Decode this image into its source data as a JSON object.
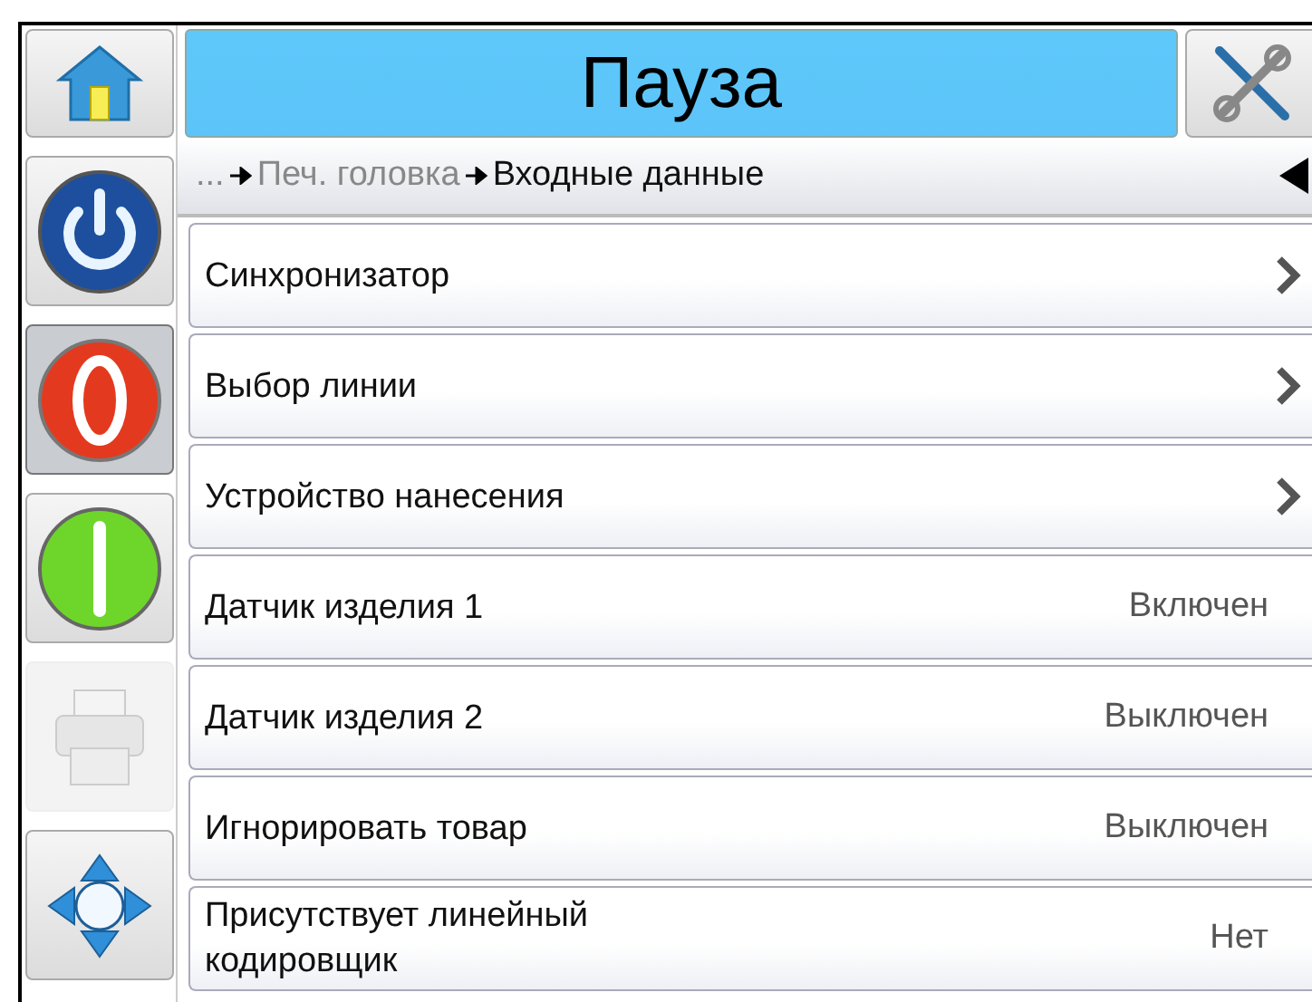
{
  "header": {
    "title": "Пауза"
  },
  "sidebar": [
    {
      "kind": "home",
      "selected": false,
      "disabled": false
    },
    {
      "kind": "power",
      "selected": false,
      "disabled": false
    },
    {
      "kind": "stop",
      "selected": true,
      "disabled": false
    },
    {
      "kind": "start",
      "selected": false,
      "disabled": false
    },
    {
      "kind": "printer",
      "selected": false,
      "disabled": true
    },
    {
      "kind": "navigate",
      "selected": false,
      "disabled": false
    }
  ],
  "breadcrumb": [
    {
      "label": "...",
      "current": false
    },
    {
      "label": "Печ. головка",
      "current": false
    },
    {
      "label": "Входные данные",
      "current": true
    }
  ],
  "rows": [
    {
      "kind": "nav",
      "label": "Синхронизатор"
    },
    {
      "kind": "nav",
      "label": "Выбор линии"
    },
    {
      "kind": "nav",
      "label": "Устройство нанесения"
    },
    {
      "kind": "value",
      "label": "Датчик изделия 1",
      "value": "Включен"
    },
    {
      "kind": "value",
      "label": "Датчик изделия 2",
      "value": "Выключен"
    },
    {
      "kind": "value",
      "label": "Игнорировать товар",
      "value": "Выключен"
    },
    {
      "kind": "value",
      "label": "Присутствует линейный кодировщик",
      "value": "Нет"
    }
  ]
}
